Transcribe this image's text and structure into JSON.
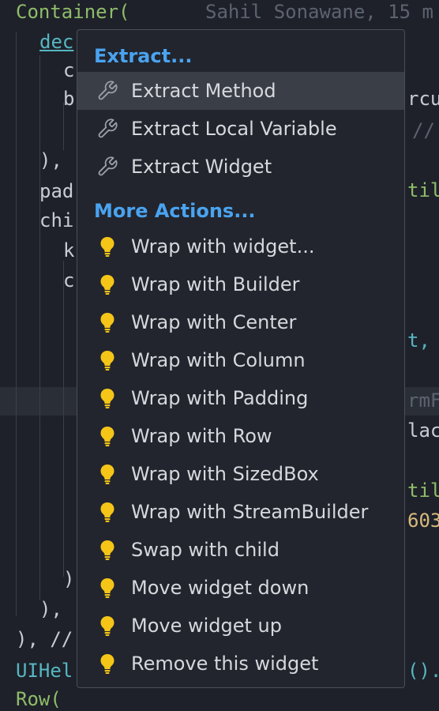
{
  "editor": {
    "lines": [
      {
        "id": "l1",
        "parts": [
          {
            "t": "Container(",
            "c": "c-green"
          }
        ]
      },
      {
        "id": "l1b",
        "parts": [
          {
            "t": "Sahil Sonawane, 15 m",
            "c": "c-gray"
          }
        ]
      },
      {
        "id": "l2",
        "parts": [
          {
            "t": "dec",
            "c": "c-cyan"
          }
        ]
      },
      {
        "id": "l3",
        "parts": [
          {
            "t": "c",
            "c": ""
          }
        ]
      },
      {
        "id": "l4",
        "parts": [
          {
            "t": "b",
            "c": ""
          }
        ]
      },
      {
        "id": "l5",
        "parts": [
          {
            "t": "),",
            "c": ""
          }
        ]
      },
      {
        "id": "l6",
        "parts": [
          {
            "t": "pad",
            "c": ""
          }
        ]
      },
      {
        "id": "l7",
        "parts": [
          {
            "t": "chi",
            "c": ""
          }
        ]
      },
      {
        "id": "l8",
        "parts": [
          {
            "t": "k",
            "c": ""
          }
        ]
      },
      {
        "id": "l9",
        "parts": [
          {
            "t": "c",
            "c": ""
          }
        ]
      },
      {
        "id": "l10",
        "parts": [
          {
            "t": ")",
            "c": ""
          }
        ]
      },
      {
        "id": "l11",
        "parts": [
          {
            "t": "),",
            "c": ""
          }
        ]
      },
      {
        "id": "l12",
        "parts": [
          {
            "t": "), //",
            "c": ""
          }
        ]
      },
      {
        "id": "l13",
        "parts": [
          {
            "t": "UIHel",
            "c": "c-cyan"
          }
        ]
      },
      {
        "id": "l14",
        "parts": [
          {
            "t": "Row(",
            "c": "c-green"
          }
        ]
      },
      {
        "id": "r1",
        "parts": [
          {
            "t": "rcu",
            "c": ""
          }
        ]
      },
      {
        "id": "r2",
        "parts": [
          {
            "t": "//",
            "c": "c-gray"
          }
        ]
      },
      {
        "id": "r3",
        "parts": [
          {
            "t": "til",
            "c": "c-green"
          }
        ]
      },
      {
        "id": "r4",
        "parts": [
          {
            "t": "t,",
            "c": "c-cyan"
          }
        ]
      },
      {
        "id": "r5",
        "parts": [
          {
            "t": "rmFi",
            "c": "c-gray"
          }
        ]
      },
      {
        "id": "r6",
        "parts": [
          {
            "t": "lac",
            "c": ""
          }
        ]
      },
      {
        "id": "r7",
        "parts": [
          {
            "t": "til",
            "c": "c-green"
          }
        ]
      },
      {
        "id": "r8",
        "parts": [
          {
            "t": "603",
            "c": "c-yellow"
          }
        ]
      },
      {
        "id": "r9",
        "parts": [
          {
            "t": "().",
            "c": "c-cyan"
          }
        ]
      }
    ]
  },
  "menu": {
    "extract_header": "Extract...",
    "extract_items": [
      {
        "label": "Extract Method",
        "icon": "wrench-icon",
        "selected": true
      },
      {
        "label": "Extract Local Variable",
        "icon": "wrench-icon",
        "selected": false
      },
      {
        "label": "Extract Widget",
        "icon": "wrench-icon",
        "selected": false
      }
    ],
    "more_header": "More Actions...",
    "more_items": [
      {
        "label": "Wrap with widget...",
        "icon": "lightbulb-icon"
      },
      {
        "label": "Wrap with Builder",
        "icon": "lightbulb-icon"
      },
      {
        "label": "Wrap with Center",
        "icon": "lightbulb-icon"
      },
      {
        "label": "Wrap with Column",
        "icon": "lightbulb-icon"
      },
      {
        "label": "Wrap with Padding",
        "icon": "lightbulb-icon"
      },
      {
        "label": "Wrap with Row",
        "icon": "lightbulb-icon"
      },
      {
        "label": "Wrap with SizedBox",
        "icon": "lightbulb-icon"
      },
      {
        "label": "Wrap with StreamBuilder",
        "icon": "lightbulb-icon"
      },
      {
        "label": "Swap with child",
        "icon": "lightbulb-icon"
      },
      {
        "label": "Move widget down",
        "icon": "lightbulb-icon"
      },
      {
        "label": "Move widget up",
        "icon": "lightbulb-icon"
      },
      {
        "label": "Remove this widget",
        "icon": "lightbulb-icon"
      }
    ]
  },
  "colors": {
    "accent": "#4aa3f0",
    "bulb": "#f5c518",
    "wrench": "#9aa0a8",
    "selected": "#3a3e47"
  }
}
